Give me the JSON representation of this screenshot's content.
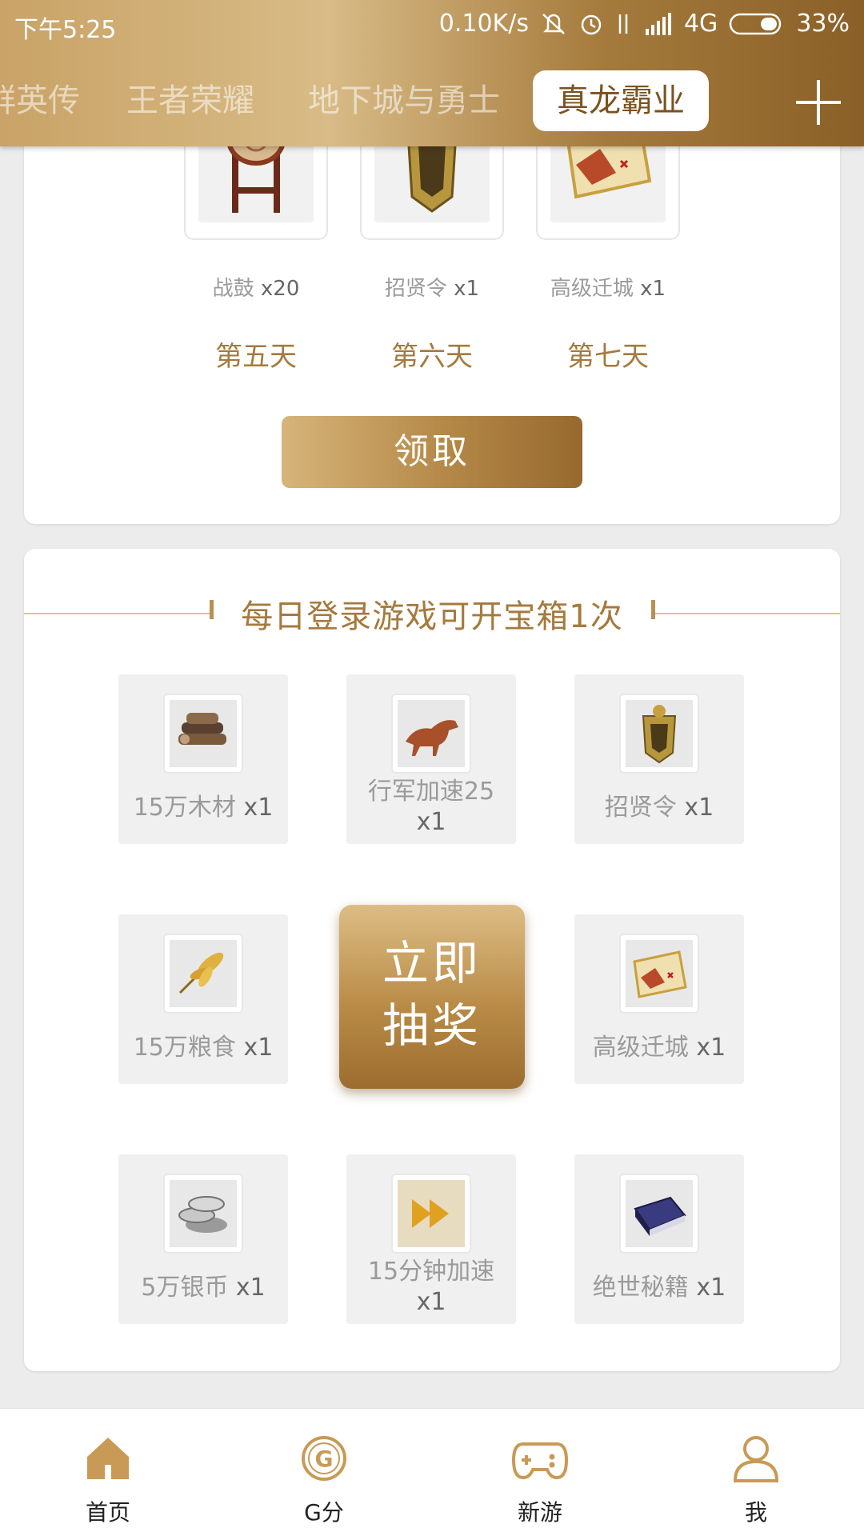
{
  "status_bar": {
    "time": "下午5:25",
    "speed": "0.10K/s",
    "network": "4G",
    "battery": "33%"
  },
  "tabs": [
    {
      "label": "群英传",
      "active": false
    },
    {
      "label": "王者荣耀",
      "active": false
    },
    {
      "label": "地下城与勇士",
      "active": false
    },
    {
      "label": "真龙霸业",
      "active": true
    }
  ],
  "login_rewards": {
    "items": [
      {
        "icon": "war-drum-icon",
        "name": "战鼓",
        "qty": "x20",
        "day": "第五天"
      },
      {
        "icon": "recruit-token-icon",
        "name": "招贤令",
        "qty": "x1",
        "day": "第六天"
      },
      {
        "icon": "relocation-scroll-icon",
        "name": "高级迁城",
        "qty": "x1",
        "day": "第七天"
      }
    ],
    "claim_label": "领取"
  },
  "lottery": {
    "title": "每日登录游戏可开宝箱1次",
    "draw_label_line1": "立即",
    "draw_label_line2": "抽奖",
    "prizes": [
      {
        "icon": "wood-icon",
        "name": "15万木材",
        "qty": "x1"
      },
      {
        "icon": "horse-icon",
        "name": "行军加速25",
        "qty": "x1"
      },
      {
        "icon": "recruit-token-icon",
        "name": "招贤令",
        "qty": "x1"
      },
      {
        "icon": "grain-icon",
        "name": "15万粮食",
        "qty": "x1"
      },
      {
        "icon": "relocation-scroll-icon",
        "name": "高级迁城",
        "qty": "x1"
      },
      {
        "icon": "silver-coins-icon",
        "name": "5万银币",
        "qty": "x1"
      },
      {
        "icon": "fast-forward-icon",
        "name": "15分钟加速",
        "qty": "x1"
      },
      {
        "icon": "secret-book-icon",
        "name": "绝世秘籍",
        "qty": "x1"
      }
    ]
  },
  "bottom_nav": [
    {
      "label": "首页",
      "icon": "home-icon"
    },
    {
      "label": "G分",
      "icon": "g-points-icon"
    },
    {
      "label": "新游",
      "icon": "gamepad-icon"
    },
    {
      "label": "我",
      "icon": "user-icon"
    }
  ],
  "colors": {
    "gold": "#a57a3c",
    "header_gradient_start": "#c9a367",
    "header_gradient_end": "#8a6028"
  }
}
